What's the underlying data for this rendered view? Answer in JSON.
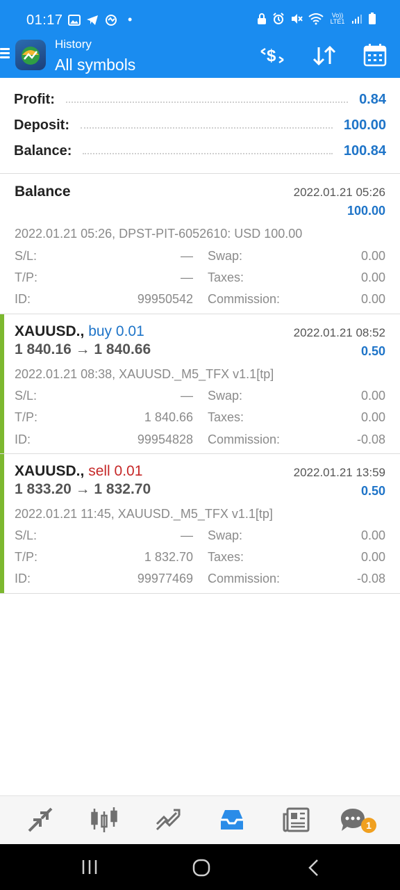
{
  "status_bar": {
    "time": "01:17",
    "dot": "•",
    "icons_left": [
      "gallery-icon",
      "telegram-icon",
      "metatrader-icon"
    ],
    "icons_right": [
      "lock-icon",
      "alarm-icon",
      "mute-icon",
      "wifi-icon",
      "volte-icon",
      "signal-icon",
      "battery-icon"
    ],
    "volte_label": "Vo)) LTE1"
  },
  "header": {
    "subtitle": "History",
    "title": "All symbols",
    "actions": [
      "currency-swap-icon",
      "sort-icon",
      "calendar-icon"
    ],
    "bg_color": "#1a8cf0"
  },
  "summary": [
    {
      "label": "Profit:",
      "value": "0.84"
    },
    {
      "label": "Deposit:",
      "value": "100.00"
    },
    {
      "label": "Balance:",
      "value": "100.84"
    }
  ],
  "deals": [
    {
      "title": "Balance",
      "time": "2022.01.21 05:26",
      "value": "100.00",
      "comment": "2022.01.21 05:26, DPST-PIT-6052610: USD 100.00",
      "sl_label": "S/L:",
      "sl": "—",
      "tp_label": "T/P:",
      "tp": "—",
      "id_label": "ID:",
      "id": "99950542",
      "swap_label": "Swap:",
      "swap": "0.00",
      "taxes_label": "Taxes:",
      "taxes": "0.00",
      "commission_label": "Commission:",
      "commission": "0.00"
    },
    {
      "symbol": "XAUUSD.,",
      "side": "buy 0.01",
      "prices": "1 840.16 → 1 840.66",
      "time": "2022.01.21 08:52",
      "value": "0.50",
      "comment": "2022.01.21 08:38, XAUUSD._M5_TFX v1.1[tp]",
      "sl_label": "S/L:",
      "sl": "—",
      "tp_label": "T/P:",
      "tp": "1 840.66",
      "id_label": "ID:",
      "id": "99954828",
      "swap_label": "Swap:",
      "swap": "0.00",
      "taxes_label": "Taxes:",
      "taxes": "0.00",
      "commission_label": "Commission:",
      "commission": "-0.08"
    },
    {
      "symbol": "XAUUSD.,",
      "side": "sell 0.01",
      "prices": "1 833.20 → 1 832.70",
      "time": "2022.01.21 13:59",
      "value": "0.50",
      "comment": "2022.01.21 11:45, XAUUSD._M5_TFX v1.1[tp]",
      "sl_label": "S/L:",
      "sl": "—",
      "tp_label": "T/P:",
      "tp": "1 832.70",
      "id_label": "ID:",
      "id": "99977469",
      "swap_label": "Swap:",
      "swap": "0.00",
      "taxes_label": "Taxes:",
      "taxes": "0.00",
      "commission_label": "Commission:",
      "commission": "-0.08"
    }
  ],
  "bottom_nav": {
    "items": [
      "quotes-icon",
      "chart-icon",
      "trade-icon",
      "history-icon",
      "news-icon",
      "messages-icon"
    ],
    "active": "history-icon",
    "messages_badge": "1"
  },
  "colors": {
    "accent": "#1e74c8",
    "sell": "#c62828",
    "trade_marker": "#7cb82f"
  }
}
